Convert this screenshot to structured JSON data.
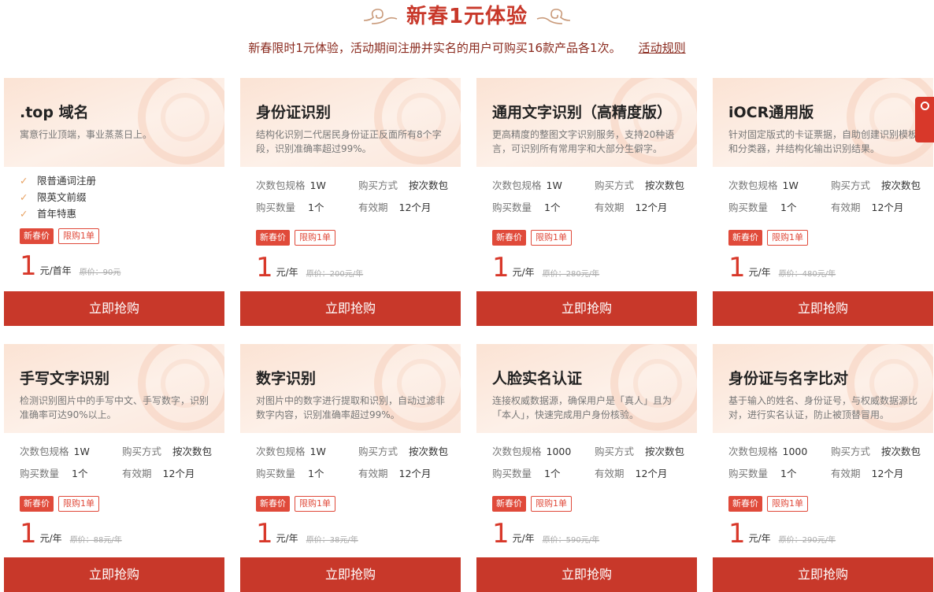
{
  "header": {
    "title": "新春1元体验",
    "subtitle": "新春限时1元体验，活动期间注册并实名的用户可购买16款产品各1次。",
    "rules_link": "活动规则"
  },
  "labels": {
    "package_spec": "次数包规格",
    "buy_method": "购买方式",
    "quantity": "购买数量",
    "validity": "有效期",
    "badge_new_year": "新春价",
    "badge_limit": "限购1单",
    "buy_button": "立即抢购"
  },
  "colors": {
    "accent": "#c8382a",
    "badge": "#e04a3a",
    "price": "#d8382a"
  },
  "products": [
    {
      "name": ".top 域名",
      "description": "寓意行业顶端，事业蒸蒸日上。",
      "features": [
        "限普通词注册",
        "限英文前缀",
        "首年特惠"
      ],
      "price": "1",
      "unit": "元/首年",
      "original": "原价：90元"
    },
    {
      "name": "身份证识别",
      "description": "结构化识别二代居民身份证正反面所有8个字段，识别准确率超过99%。",
      "spec": "1W",
      "method": "按次数包",
      "qty": "1个",
      "validity": "12个月",
      "price": "1",
      "unit": "元/年",
      "original": "原价：200元/年"
    },
    {
      "name": "通用文字识别（高精度版）",
      "description": "更高精度的整图文字识别服务，支持20种语言，可识别所有常用字和大部分生僻字。",
      "spec": "1W",
      "method": "按次数包",
      "qty": "1个",
      "validity": "12个月",
      "price": "1",
      "unit": "元/年",
      "original": "原价：280元/年"
    },
    {
      "name": "iOCR通用版",
      "description": "针对固定版式的卡证票据，自助创建识别模板和分类器，并结构化输出识别结果。",
      "spec": "1W",
      "method": "按次数包",
      "qty": "1个",
      "validity": "12个月",
      "price": "1",
      "unit": "元/年",
      "original": "原价：480元/年"
    },
    {
      "name": "手写文字识别",
      "description": "检测识别图片中的手写中文、手写数字，识别准确率可达90%以上。",
      "spec": "1W",
      "method": "按次数包",
      "qty": "1个",
      "validity": "12个月",
      "price": "1",
      "unit": "元/年",
      "original": "原价：88元/年"
    },
    {
      "name": "数字识别",
      "description": "对图片中的数字进行提取和识别，自动过滤非数字内容，识别准确率超过99%。",
      "spec": "1W",
      "method": "按次数包",
      "qty": "1个",
      "validity": "12个月",
      "price": "1",
      "unit": "元/年",
      "original": "原价：38元/年"
    },
    {
      "name": "人脸实名认证",
      "description": "连接权威数据源，确保用户是「真人」且为「本人」，快速完成用户身份核验。",
      "spec": "1000",
      "method": "按次数包",
      "qty": "1个",
      "validity": "12个月",
      "price": "1",
      "unit": "元/年",
      "original": "原价：590元/年"
    },
    {
      "name": "身份证与名字比对",
      "description": "基于输入的姓名、身份证号，与权威数据源比对，进行实名认证，防止被顶替冒用。",
      "spec": "1000",
      "method": "按次数包",
      "qty": "1个",
      "validity": "12个月",
      "price": "1",
      "unit": "元/年",
      "original": "原价：290元/年"
    }
  ]
}
